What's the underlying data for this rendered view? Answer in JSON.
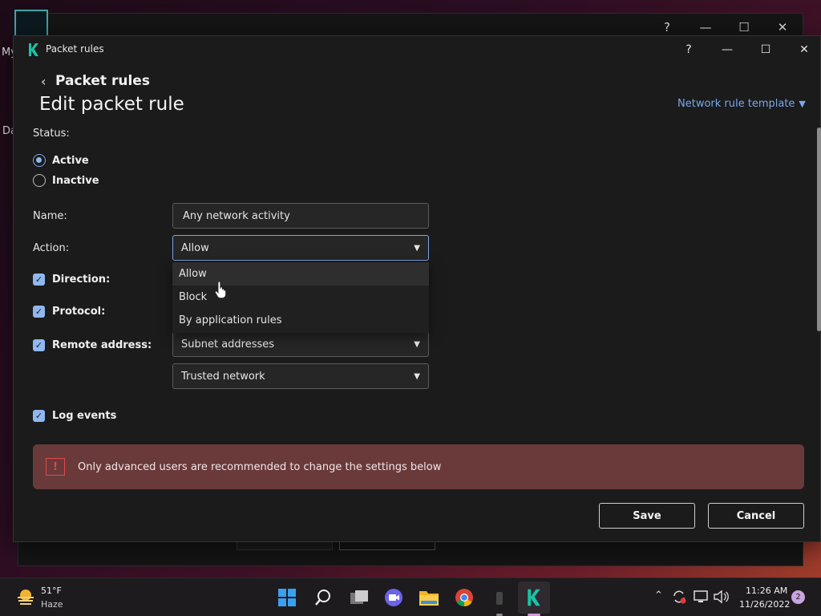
{
  "background": {
    "left_text_1": "My",
    "left_text_2": "Da",
    "controls": {
      "help": "?",
      "minimize": "—",
      "maximize": "☐",
      "close": "✕"
    }
  },
  "dialog": {
    "title": "Packet rules",
    "controls": {
      "help": "?",
      "minimize": "—",
      "maximize": "☐",
      "close": "✕"
    },
    "back_label": "Packet rules",
    "page_title": "Edit packet rule",
    "template_link": "Network rule template"
  },
  "form": {
    "status_label": "Status:",
    "status_options": [
      "Active",
      "Inactive"
    ],
    "status_selected": "Active",
    "name_label": "Name:",
    "name_value": "Any network activity",
    "action_label": "Action:",
    "action_value": "Allow",
    "action_options": [
      "Allow",
      "Block",
      "By application rules"
    ],
    "direction_label": "Direction:",
    "protocol_label": "Protocol:",
    "remote_label": "Remote address:",
    "remote_value": "Subnet addresses",
    "trusted_value": "Trusted network",
    "log_label": "Log events"
  },
  "warning": {
    "icon": "!",
    "text": "Only advanced users are recommended to change the settings below"
  },
  "buttons": {
    "save": "Save",
    "cancel": "Cancel"
  },
  "taskbar": {
    "temperature": "51°F",
    "condition": "Haze",
    "time": "11:26 AM",
    "date": "11/26/2022",
    "notifications": "2"
  },
  "colors": {
    "accent": "#7aa7e8",
    "warning_bg": "#6a3a3b",
    "warning_icon": "#e04a4a",
    "brand": "#18c4a8"
  }
}
